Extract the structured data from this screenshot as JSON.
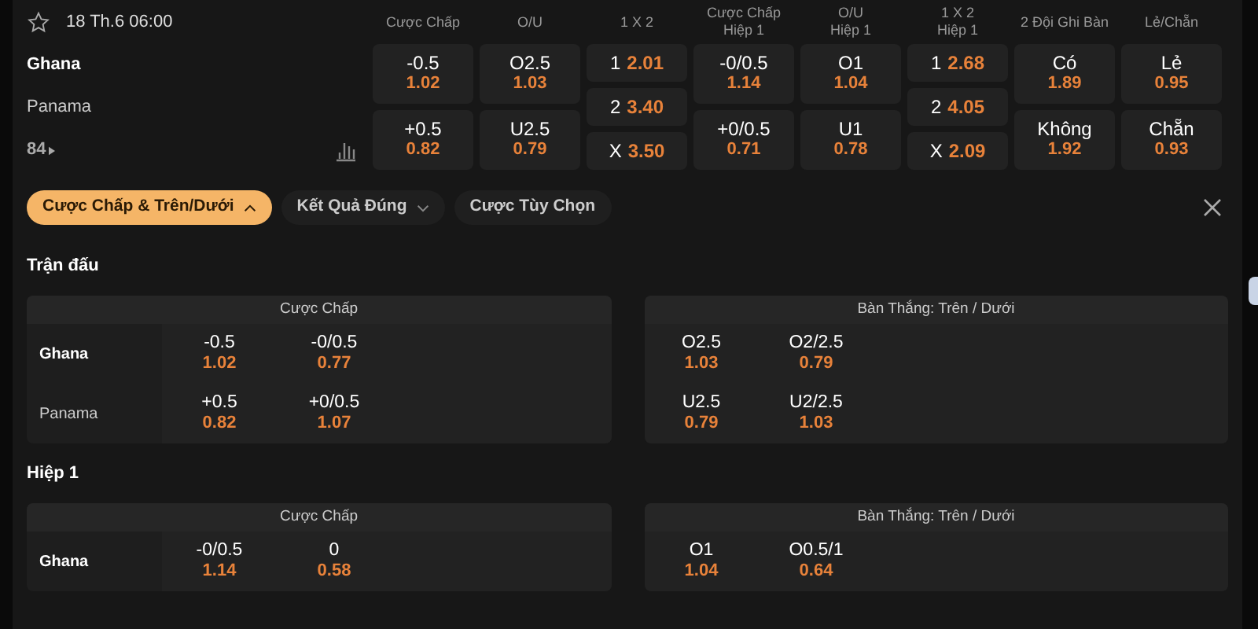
{
  "match": {
    "date": "18 Th.6 06:00",
    "teams": [
      "Ghana",
      "Panama"
    ],
    "more": "84"
  },
  "columns": [
    [
      "Cược Chấp"
    ],
    [
      "O/U"
    ],
    [
      "1 X 2"
    ],
    [
      "Cược Chấp",
      "Hiệp 1"
    ],
    [
      "O/U",
      "Hiệp 1"
    ],
    [
      "1 X 2",
      "Hiệp 1"
    ],
    [
      "2 Đội Ghi Bàn"
    ],
    [
      "Lẻ/Chẵn"
    ]
  ],
  "markets": [
    {
      "kind": "pair",
      "cells": [
        {
          "line": "-0.5",
          "odds": "1.02"
        },
        {
          "line": "+0.5",
          "odds": "0.82"
        }
      ]
    },
    {
      "kind": "pair",
      "cells": [
        {
          "line": "O2.5",
          "odds": "1.03"
        },
        {
          "line": "U2.5",
          "odds": "0.79"
        }
      ]
    },
    {
      "kind": "triple",
      "cells": [
        {
          "line": "1",
          "odds": "2.01"
        },
        {
          "line": "2",
          "odds": "3.40"
        },
        {
          "line": "X",
          "odds": "3.50"
        }
      ]
    },
    {
      "kind": "pair",
      "cells": [
        {
          "line": "-0/0.5",
          "odds": "1.14"
        },
        {
          "line": "+0/0.5",
          "odds": "0.71"
        }
      ]
    },
    {
      "kind": "pair",
      "cells": [
        {
          "line": "O1",
          "odds": "1.04"
        },
        {
          "line": "U1",
          "odds": "0.78"
        }
      ]
    },
    {
      "kind": "triple",
      "cells": [
        {
          "line": "1",
          "odds": "2.68"
        },
        {
          "line": "2",
          "odds": "4.05"
        },
        {
          "line": "X",
          "odds": "2.09"
        }
      ]
    },
    {
      "kind": "pair",
      "cells": [
        {
          "line": "Có",
          "odds": "1.89"
        },
        {
          "line": "Không",
          "odds": "1.92"
        }
      ]
    },
    {
      "kind": "pair",
      "cells": [
        {
          "line": "Lẻ",
          "odds": "0.95"
        },
        {
          "line": "Chẵn",
          "odds": "0.93"
        }
      ]
    }
  ],
  "filters": [
    {
      "label": "Cược Chấp & Trên/Dưới",
      "kind": "dropdown",
      "selected": true,
      "expanded": true
    },
    {
      "label": "Kết Quả Đúng",
      "kind": "dropdown",
      "selected": false,
      "expanded": false
    },
    {
      "label": "Cược Tùy Chọn",
      "kind": "button",
      "selected": false
    }
  ],
  "sections": [
    {
      "title": "Trận đấu",
      "tables": [
        {
          "title": "Cược Chấp",
          "rows": [
            {
              "team": "Ghana",
              "bold": true,
              "cells": [
                {
                  "line": "-0.5",
                  "odds": "1.02"
                },
                {
                  "line": "-0/0.5",
                  "odds": "0.77"
                }
              ]
            },
            {
              "team": "Panama",
              "bold": false,
              "cells": [
                {
                  "line": "+0.5",
                  "odds": "0.82"
                },
                {
                  "line": "+0/0.5",
                  "odds": "1.07"
                }
              ]
            }
          ]
        },
        {
          "title": "Bàn Thắng: Trên / Dưới",
          "rows": [
            {
              "cells": [
                {
                  "line": "O2.5",
                  "odds": "1.03"
                },
                {
                  "line": "O2/2.5",
                  "odds": "0.79"
                }
              ]
            },
            {
              "cells": [
                {
                  "line": "U2.5",
                  "odds": "0.79"
                },
                {
                  "line": "U2/2.5",
                  "odds": "1.03"
                }
              ]
            }
          ]
        }
      ]
    },
    {
      "title": "Hiệp 1",
      "tables": [
        {
          "title": "Cược Chấp",
          "rows": [
            {
              "team": "Ghana",
              "bold": true,
              "cells": [
                {
                  "line": "-0/0.5",
                  "odds": "1.14"
                },
                {
                  "line": "0",
                  "odds": "0.58"
                }
              ]
            }
          ]
        },
        {
          "title": "Bàn Thắng: Trên / Dưới",
          "rows": [
            {
              "cells": [
                {
                  "line": "O1",
                  "odds": "1.04"
                },
                {
                  "line": "O0.5/1",
                  "odds": "0.64"
                }
              ]
            }
          ]
        }
      ]
    }
  ]
}
